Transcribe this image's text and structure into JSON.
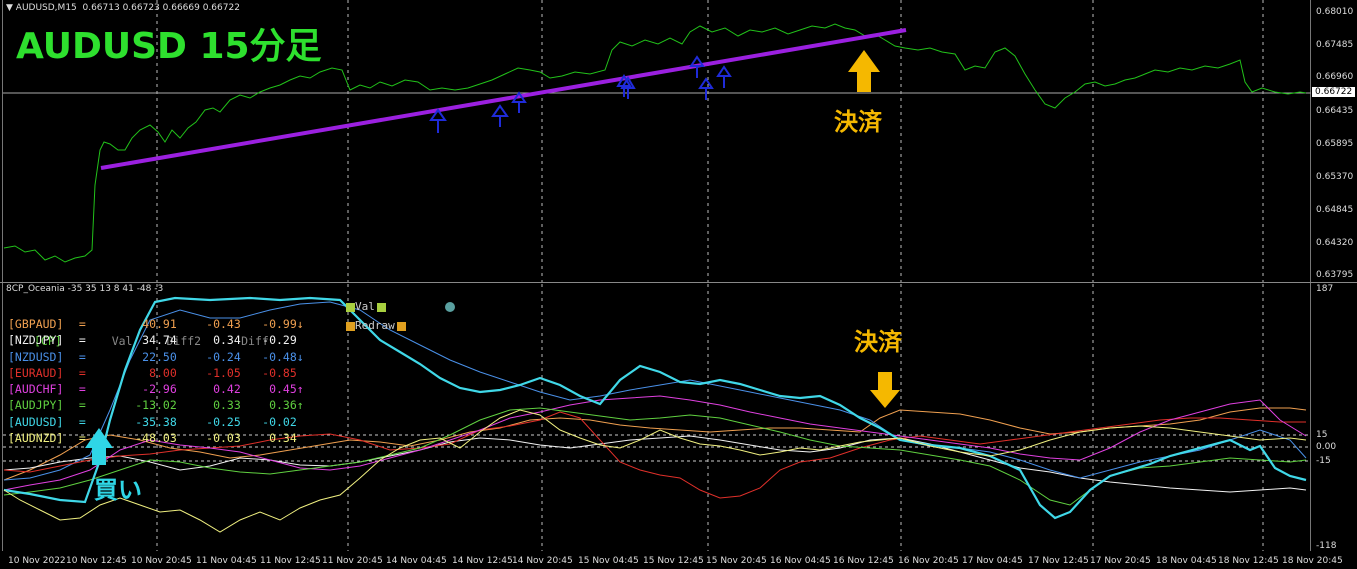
{
  "main_chart": {
    "header": "▼ AUDUSD,M15  0.66713 0.66723 0.66669 0.66722",
    "title_overlay": "AUDUSD 15分足",
    "close_annotation": "決済",
    "current_price": "0.66722",
    "y_labels": [
      "0.68010",
      "0.67485",
      "0.66960",
      "0.66435",
      "0.65895",
      "0.65370",
      "0.64845",
      "0.64320",
      "0.63795"
    ],
    "colors": {
      "price": "#22c21a",
      "trendline": "#9b20e0",
      "signal_arrow": "#1f2bd9",
      "annotation": "#f5b800"
    }
  },
  "indicator": {
    "header": "8CP_Oceania -35 35 13 8 41 -48 -3",
    "buy_annotation": "買い",
    "close_annotation": "決済",
    "y_labels": [
      "187",
      "15",
      "0.00",
      "-15",
      "-118"
    ],
    "legend": {
      "val": "Val",
      "redraw": "Redraw"
    },
    "table_header": {
      "cp": "[CP]",
      "val": "Val",
      "diff2": "Diff2",
      "diff": "Diff"
    },
    "rows": [
      {
        "pair": "[GBPAUD]",
        "val": "40.91",
        "diff2": "-0.43",
        "diff": "-0.99",
        "arrow": "↓",
        "color": "#f0a050"
      },
      {
        "pair": "[NZDJPY]",
        "val": "34.74",
        "diff2": "0.34",
        "diff": "-0.29",
        "arrow": "",
        "color": "#f2f2f2"
      },
      {
        "pair": "[NZDUSD]",
        "val": "22.50",
        "diff2": "-0.24",
        "diff": "-0.48",
        "arrow": "↓",
        "color": "#4a90e8"
      },
      {
        "pair": "[EURAUD]",
        "val": "8.00",
        "diff2": "-1.05",
        "diff": "-0.85",
        "arrow": "",
        "color": "#e0302a"
      },
      {
        "pair": "[AUDCHF]",
        "val": "-2.96",
        "diff2": "0.42",
        "diff": "0.45",
        "arrow": "↑",
        "color": "#e040e0"
      },
      {
        "pair": "[AUDJPY]",
        "val": "-13.02",
        "diff2": "0.33",
        "diff": "0.36",
        "arrow": "↑",
        "color": "#60d040"
      },
      {
        "pair": "[AUDUSD]",
        "val": "-35.38",
        "diff2": "-0.25",
        "diff": "-0.02",
        "arrow": "",
        "color": "#40d8e8"
      },
      {
        "pair": "[AUDNZD]",
        "val": "-48.03",
        "diff2": "-0.03",
        "diff": "0.34",
        "arrow": "",
        "color": "#f0f080"
      }
    ]
  },
  "x_labels": [
    "10 Nov 2022",
    "10 Nov 12:45",
    "10 Nov 20:45",
    "11 Nov 04:45",
    "11 Nov 12:45",
    "11 Nov 20:45",
    "14 Nov 04:45",
    "14 Nov 12:45",
    "14 Nov 20:45",
    "15 Nov 04:45",
    "15 Nov 12:45",
    "15 Nov 20:45",
    "16 Nov 04:45",
    "16 Nov 12:45",
    "16 Nov 20:45",
    "17 Nov 04:45",
    "17 Nov 12:45",
    "17 Nov 20:45",
    "18 Nov 04:45",
    "18 Nov 12:45",
    "18 Nov 20:45"
  ]
}
